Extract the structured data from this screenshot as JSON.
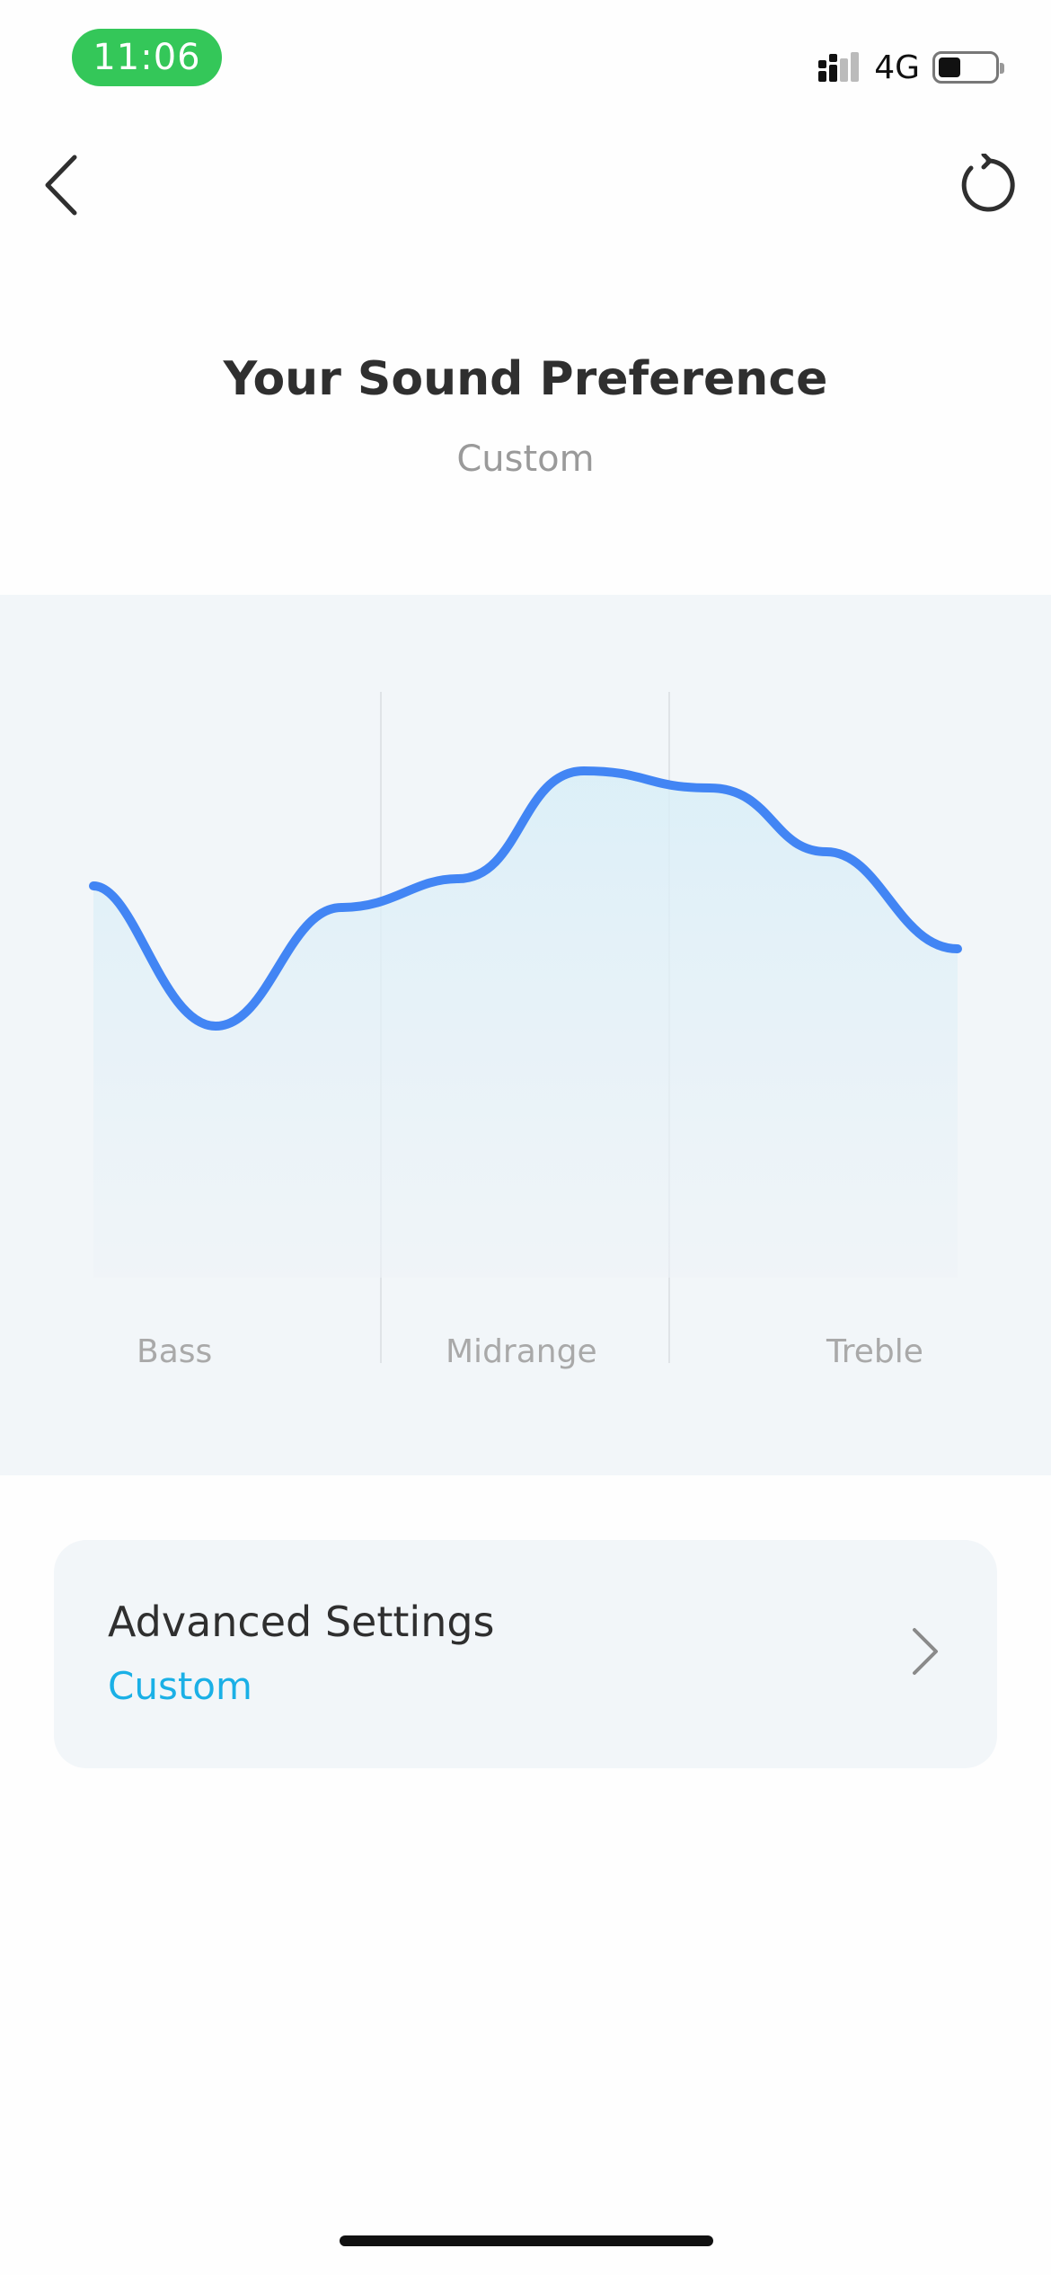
{
  "status_bar": {
    "time": "11:06",
    "network": "4G",
    "time_pill_color": "#34c759"
  },
  "nav": {
    "back_icon": "chevron-left-icon",
    "reset_icon": "reset-icon"
  },
  "header": {
    "title": "Your Sound Preference",
    "subtitle": "Custom"
  },
  "eq_curve": {
    "bands": [
      "Bass",
      "Midrange",
      "Treble"
    ],
    "line_color": "#4285f4"
  },
  "advanced_settings": {
    "label": "Advanced Settings",
    "value": "Custom",
    "value_color": "#1ab0e6"
  }
}
